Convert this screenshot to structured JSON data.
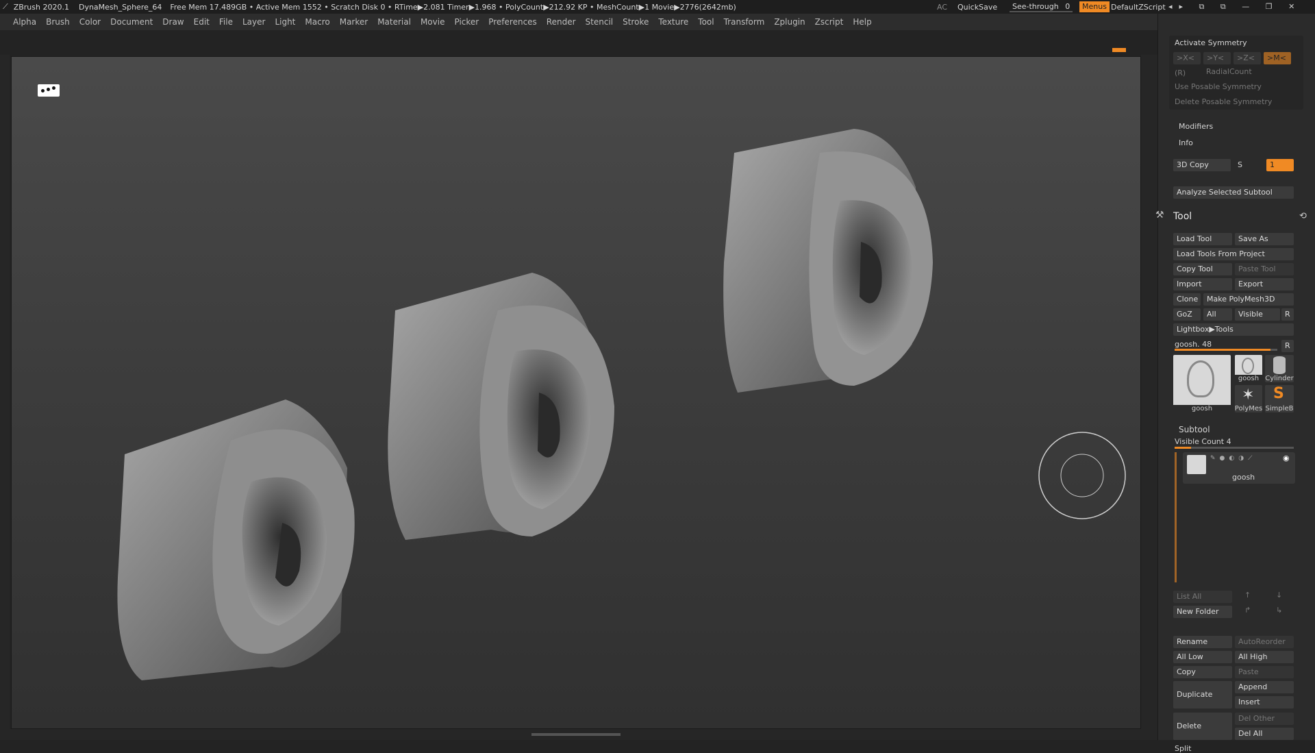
{
  "titlebar": {
    "app": "ZBrush 2020.1",
    "project": "DynaMesh_Sphere_64",
    "status": "Free Mem 17.489GB • Active Mem 1552 • Scratch Disk 0 • RTime▶2.081 Timer▶1.968 • PolyCount▶212.92 KP • MeshCount▶1 Movie▶2776(2642mb)",
    "ac": "AC",
    "quicksave": "QuickSave",
    "see_through_label": "See-through",
    "see_through_value": "0",
    "menus": "Menus",
    "script": "DefaultZScript"
  },
  "menubar": [
    "Alpha",
    "Brush",
    "Color",
    "Document",
    "Draw",
    "Edit",
    "File",
    "Layer",
    "Light",
    "Macro",
    "Marker",
    "Material",
    "Movie",
    "Picker",
    "Preferences",
    "Render",
    "Stencil",
    "Stroke",
    "Texture",
    "Tool",
    "Transform",
    "Zplugin",
    "Zscript",
    "Help"
  ],
  "symmetry": {
    "activate": "Activate Symmetry",
    "x": ">X<",
    "y": ">Y<",
    "z": ">Z<",
    "m": ">M<",
    "r": "(R)",
    "radial": "RadialCount",
    "posable": "Use Posable Symmetry",
    "delete_posable": "Delete Posable Symmetry"
  },
  "modifiers": "Modifiers",
  "info": "Info",
  "copy3d": {
    "label": "3D Copy",
    "s": "S",
    "value": "1"
  },
  "analyze": "Analyze Selected Subtool",
  "tool": {
    "title": "Tool",
    "load": "Load Tool",
    "save_as": "Save As",
    "load_project": "Load Tools From Project",
    "copy": "Copy Tool",
    "paste": "Paste Tool",
    "import": "Import",
    "export": "Export",
    "clone": "Clone",
    "polymesh": "Make PolyMesh3D",
    "goz": "GoZ",
    "all": "All",
    "visible": "Visible",
    "r": "R",
    "lightbox": "Lightbox▶Tools",
    "current": "goosh. 48",
    "r2": "R",
    "thumbs": [
      {
        "name": "goosh",
        "icon": "ear-thumbnail-icon"
      },
      {
        "name": "goosh",
        "icon": "ear-thumbnail-icon"
      },
      {
        "name": "Cylinder",
        "icon": "cylinder-icon"
      },
      {
        "name": "PolyMes",
        "icon": "star-icon"
      },
      {
        "name": "SimpleB",
        "icon": "simplebrush-icon"
      }
    ]
  },
  "subtool": {
    "title": "Subtool",
    "visible_count": "Visible Count 4",
    "item": "goosh",
    "list_all": "List All",
    "new_folder": "New Folder",
    "rename": "Rename",
    "autoreorder": "AutoReorder",
    "all_low": "All Low",
    "all_high": "All High",
    "copy": "Copy",
    "paste": "Paste",
    "duplicate": "Duplicate",
    "append": "Append",
    "insert": "Insert",
    "delete": "Delete",
    "del_other": "Del Other",
    "del_all": "Del All",
    "split": "Split"
  },
  "colors": {
    "accent": "#f08a24",
    "bg": "#232323",
    "panel": "#2b2b2b"
  }
}
